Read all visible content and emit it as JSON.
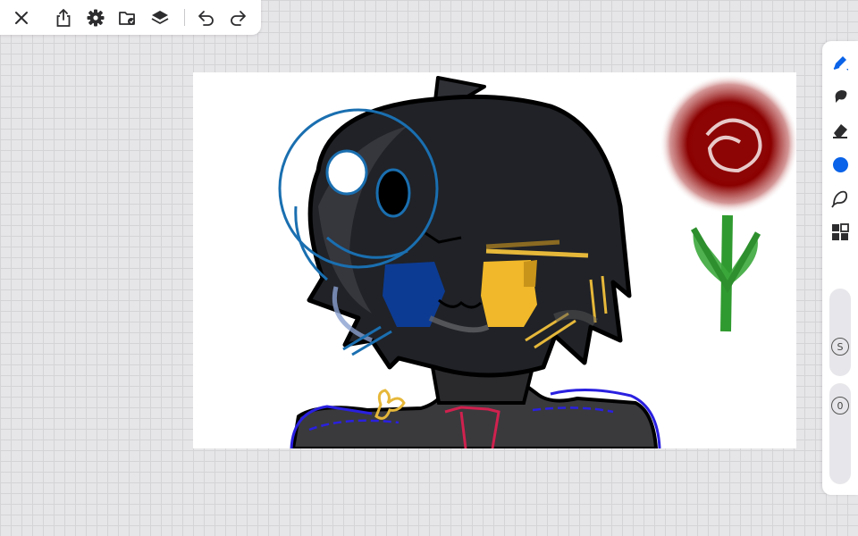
{
  "toolbar": {
    "icons": [
      "close-icon",
      "share-icon",
      "settings-icon",
      "gallery-icon",
      "layers-icon",
      "undo-icon",
      "redo-icon"
    ]
  },
  "sidebar": {
    "tools": [
      "pen-icon",
      "smudge-icon",
      "eraser-icon",
      "color-icon",
      "lasso-icon",
      "elements-icon"
    ],
    "current_color": "#0a63e8",
    "size_label": "S",
    "opacity_label": "0"
  },
  "canvas": {
    "background": "#ffffff",
    "artwork": "drawing"
  },
  "colors": {
    "accent": "#0a63e8",
    "icon": "#2c2c2e"
  }
}
